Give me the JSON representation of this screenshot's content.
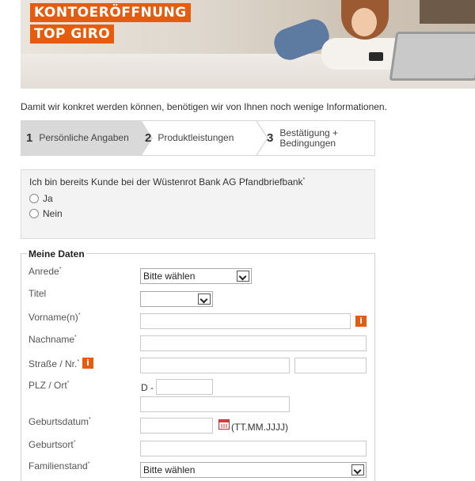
{
  "banner": {
    "line1": "KONTOERÖFFNUNG",
    "line2": "TOP GIRO"
  },
  "intro": "Damit wir konkret werden können, benötigen wir von Ihnen noch wenige Informationen.",
  "steps": [
    {
      "num": "1",
      "label": "Persönliche Angaben"
    },
    {
      "num": "2",
      "label": "Produktleistungen"
    },
    {
      "num": "3",
      "label": "Bestätigung +\nBedingungen"
    }
  ],
  "customer": {
    "question": "Ich bin bereits Kunde bei der Wüstenrot Bank AG Pfandbriefbank",
    "required_mark": "*",
    "options": [
      "Ja",
      "Nein"
    ]
  },
  "form": {
    "legend": "Meine Daten",
    "anrede_label": "Anrede",
    "anrede_value": "Bitte wählen",
    "titel_label": "Titel",
    "titel_value": "",
    "vorname_label": "Vorname(n)",
    "nachname_label": "Nachname",
    "strasse_label": "Straße / Nr.",
    "plz_label": "PLZ / Ort",
    "plz_prefix": "D -",
    "geburtsdatum_label": "Geburtsdatum",
    "date_format": "(TT.MM.JJJJ)",
    "geburtsort_label": "Geburtsort",
    "familienstand_label": "Familienstand",
    "familienstand_value": "Bitte wählen",
    "required_mark": "*",
    "info_glyph": "i"
  },
  "colors": {
    "accent": "#e65c0f",
    "step_active_bg": "#d9d9d9"
  }
}
